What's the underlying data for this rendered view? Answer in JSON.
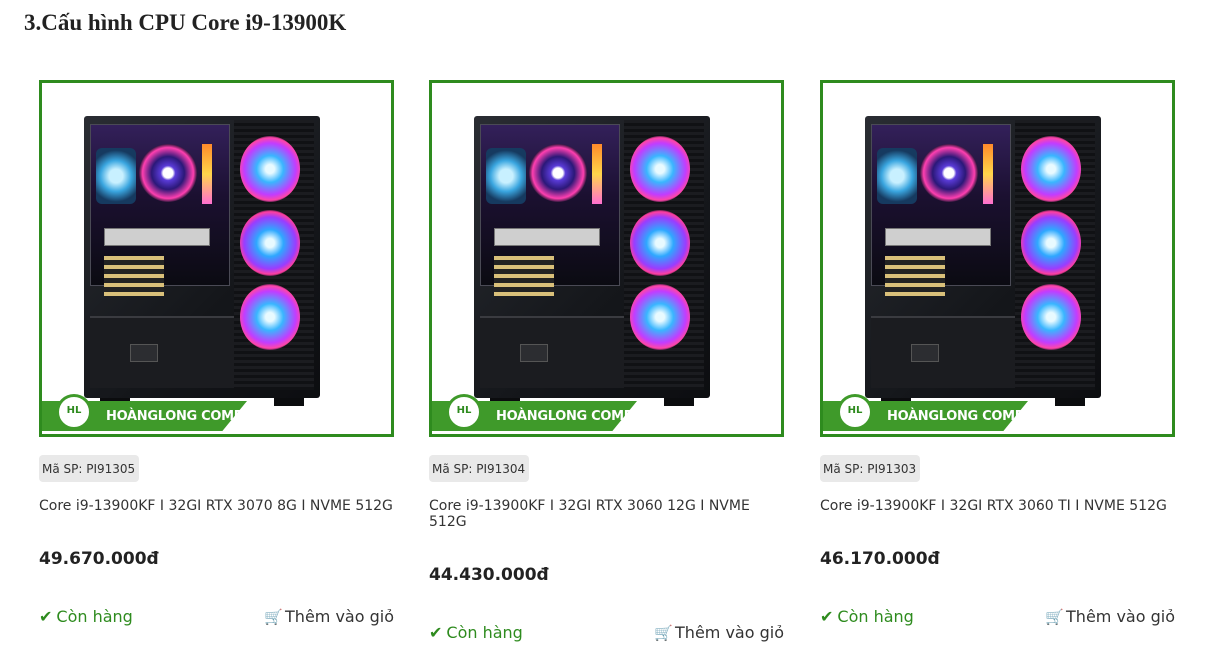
{
  "section": {
    "title": "3.Cấu hình CPU Core i9-13900K"
  },
  "brand": {
    "name": "HOÀNGLONG COMPUTER",
    "logo_text": "HL",
    "accent": "#2e8b1e"
  },
  "products": [
    {
      "sku": "Mã SP: PI91305",
      "name": "Core i9-13900KF I 32GI RTX 3070 8G I NVME 512G",
      "price": "49.670.000đ",
      "stock": "Còn hàng",
      "cart": "Thêm vào giỏ"
    },
    {
      "sku": "Mã SP: PI91304",
      "name": "Core i9-13900KF I 32GI RTX 3060 12G I NVME 512G",
      "price": "44.430.000đ",
      "stock": "Còn hàng",
      "cart": "Thêm vào giỏ"
    },
    {
      "sku": "Mã SP: PI91303",
      "name": "Core i9-13900KF I 32GI RTX 3060 TI I NVME 512G",
      "price": "46.170.000đ",
      "stock": "Còn hàng",
      "cart": "Thêm vào giỏ"
    }
  ],
  "icons": {
    "stock": "check-icon",
    "cart": "cart-icon"
  }
}
